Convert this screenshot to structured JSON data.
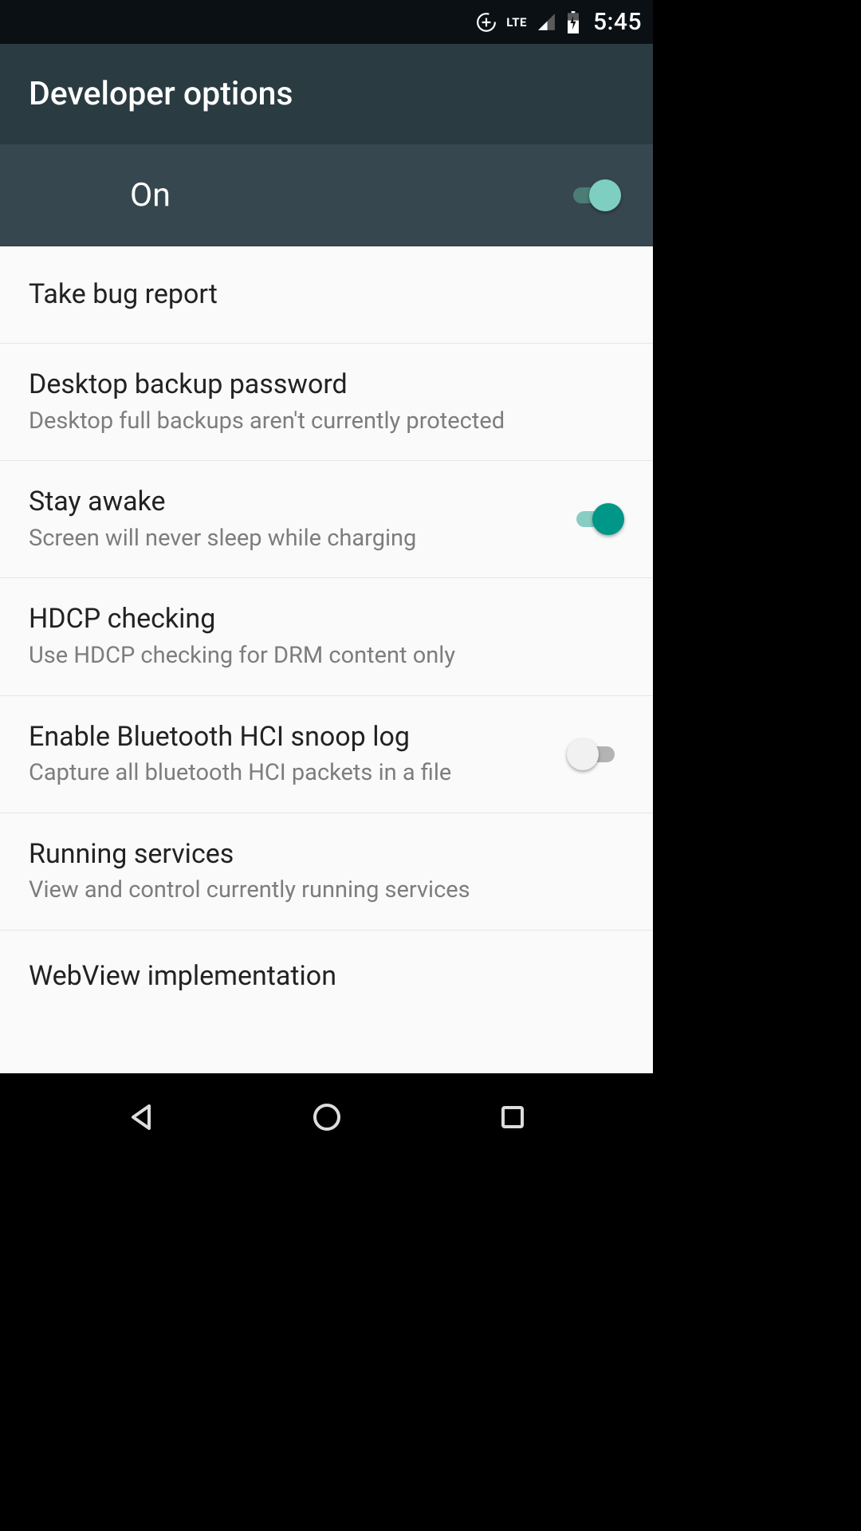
{
  "status": {
    "time": "5:45",
    "network_label": "LTE"
  },
  "header": {
    "title": "Developer options"
  },
  "master": {
    "label": "On",
    "enabled": true
  },
  "settings": [
    {
      "id": "bug-report",
      "title": "Take bug report",
      "subtitle": null,
      "toggle": null
    },
    {
      "id": "desktop-backup",
      "title": "Desktop backup password",
      "subtitle": "Desktop full backups aren't currently protected",
      "toggle": null
    },
    {
      "id": "stay-awake",
      "title": "Stay awake",
      "subtitle": "Screen will never sleep while charging",
      "toggle": true
    },
    {
      "id": "hdcp",
      "title": "HDCP checking",
      "subtitle": "Use HDCP checking for DRM content only",
      "toggle": null
    },
    {
      "id": "bt-hci-snoop",
      "title": "Enable Bluetooth HCI snoop log",
      "subtitle": "Capture all bluetooth HCI packets in a file",
      "toggle": false
    },
    {
      "id": "running-services",
      "title": "Running services",
      "subtitle": "View and control currently running services",
      "toggle": null
    },
    {
      "id": "webview",
      "title": "WebView implementation",
      "subtitle": null,
      "toggle": null,
      "cutoff": true
    }
  ]
}
